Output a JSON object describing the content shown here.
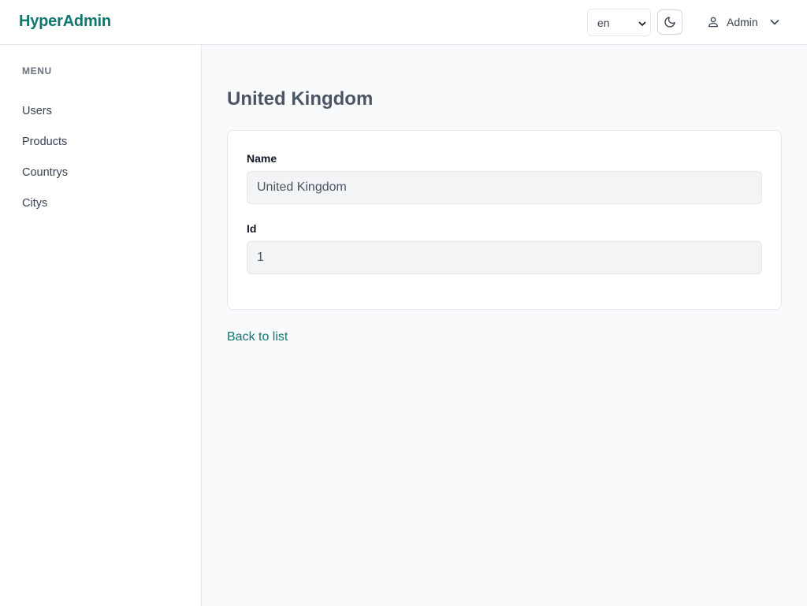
{
  "header": {
    "brand": "HyperAdmin",
    "language": {
      "selected": "en"
    },
    "user": {
      "name": "Admin"
    }
  },
  "sidebar": {
    "heading": "MENU",
    "items": [
      {
        "label": "Users"
      },
      {
        "label": "Products"
      },
      {
        "label": "Countrys"
      },
      {
        "label": "Citys"
      }
    ]
  },
  "main": {
    "title": "United Kingdom",
    "fields": [
      {
        "label": "Name",
        "value": "United Kingdom"
      },
      {
        "label": "Id",
        "value": "1"
      }
    ],
    "back_link": "Back to list"
  },
  "colors": {
    "brand": "#0f766e",
    "link": "#0f766e"
  },
  "icons": {
    "theme": "moon-icon",
    "user": "user-icon",
    "chevron": "chevron-down-icon"
  }
}
